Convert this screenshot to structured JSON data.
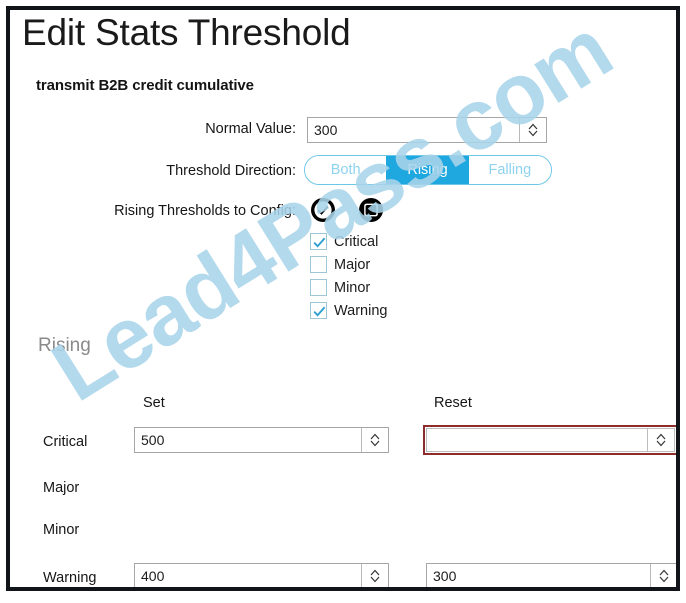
{
  "window": {
    "title": "Edit Stats Threshold",
    "subtitle": "transmit B2B credit cumulative"
  },
  "form": {
    "normal_value": {
      "label": "Normal Value:",
      "value": "300"
    },
    "threshold_direction": {
      "label": "Threshold Direction:",
      "options": [
        "Both",
        "Rising",
        "Falling"
      ],
      "selected": "Rising"
    },
    "rising_thresholds_to_config": {
      "label": "Rising Thresholds to Config:",
      "check_all_icon": "circle-check-icon",
      "clear_all_icon": "circle-square-icon",
      "items": [
        {
          "label": "Critical",
          "checked": true
        },
        {
          "label": "Major",
          "checked": false
        },
        {
          "label": "Minor",
          "checked": false
        },
        {
          "label": "Warning",
          "checked": true
        }
      ]
    }
  },
  "rising_section": {
    "heading": "Rising",
    "columns": [
      "Set",
      "Reset"
    ],
    "rows": [
      {
        "severity": "Critical",
        "set": "500",
        "reset": "",
        "reset_error": true,
        "has_set_field": true,
        "has_reset_field": true
      },
      {
        "severity": "Major",
        "set": "",
        "reset": "",
        "reset_error": false,
        "has_set_field": false,
        "has_reset_field": false
      },
      {
        "severity": "Minor",
        "set": "",
        "reset": "",
        "reset_error": false,
        "has_set_field": false,
        "has_reset_field": false
      },
      {
        "severity": "Warning",
        "set": "400",
        "reset": "300",
        "reset_error": false,
        "has_set_field": true,
        "has_reset_field": true
      }
    ]
  },
  "watermark": {
    "text": "Lead4Pass.com"
  },
  "colors": {
    "accent": "#1fa7e0",
    "accent_light": "#8fd3ef",
    "pill_border": "#6cc6e8",
    "error_border": "#8e2b2b",
    "frame": "#111418",
    "section_heading": "#8a8a8a",
    "watermark": "#a9d4ea"
  }
}
